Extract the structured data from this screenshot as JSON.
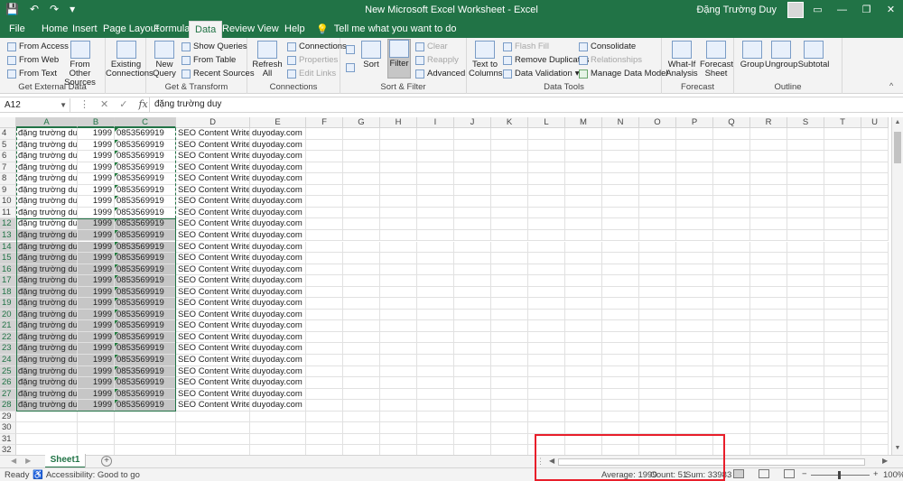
{
  "window": {
    "title": "New Microsoft Excel Worksheet  -  Excel",
    "user": "Đặng Trường Duy"
  },
  "tabs": [
    "File",
    "Home",
    "Insert",
    "Page Layout",
    "Formulas",
    "Data",
    "Review",
    "View",
    "Help"
  ],
  "active_tab": "Data",
  "tell_me": "Tell me what you want to do",
  "ribbon": {
    "get_external": {
      "label": "Get External Data",
      "from_access": "From Access",
      "from_web": "From Web",
      "from_text": "From Text",
      "from_other_1": "From Other",
      "from_other_2": "Sources",
      "existing_1": "Existing",
      "existing_2": "Connections"
    },
    "get_transform": {
      "label": "Get & Transform",
      "new_query_1": "New",
      "new_query_2": "Query",
      "show_queries": "Show Queries",
      "from_table": "From Table",
      "recent_sources": "Recent Sources"
    },
    "connections": {
      "label": "Connections",
      "refresh_1": "Refresh",
      "refresh_2": "All",
      "connections": "Connections",
      "properties": "Properties",
      "edit_links": "Edit Links"
    },
    "sort_filter": {
      "label": "Sort & Filter",
      "sort": "Sort",
      "filter": "Filter",
      "clear": "Clear",
      "reapply": "Reapply",
      "advanced": "Advanced"
    },
    "data_tools": {
      "label": "Data Tools",
      "text_to_columns_1": "Text to",
      "text_to_columns_2": "Columns",
      "flash_fill": "Flash Fill",
      "remove_duplicates": "Remove Duplicates",
      "data_validation": "Data Validation",
      "consolidate": "Consolidate",
      "relationships": "Relationships",
      "manage_data_model": "Manage Data Model"
    },
    "forecast": {
      "label": "Forecast",
      "whatif_1": "What-If",
      "whatif_2": "Analysis",
      "forecast_1": "Forecast",
      "forecast_2": "Sheet"
    },
    "outline": {
      "label": "Outline",
      "group": "Group",
      "ungroup": "Ungroup",
      "subtotal": "Subtotal"
    }
  },
  "formula_bar": {
    "name_box": "A12",
    "value": "đặng trường duy",
    "fx": "fx"
  },
  "columns": [
    "A",
    "B",
    "C",
    "D",
    "E",
    "F",
    "G",
    "H",
    "I",
    "J",
    "K",
    "L",
    "M",
    "N",
    "O",
    "P",
    "Q",
    "R",
    "S",
    "T",
    "U"
  ],
  "rows": [
    {
      "n": "4",
      "a": "đặng trường duy",
      "b": "1999",
      "c": "0853569919",
      "d": "SEO Content Writer",
      "e": "duyoday.com"
    },
    {
      "n": "5",
      "a": "đặng trường duy",
      "b": "1999",
      "c": "0853569919",
      "d": "SEO Content Writer",
      "e": "duyoday.com"
    },
    {
      "n": "6",
      "a": "đặng trường duy",
      "b": "1999",
      "c": "0853569919",
      "d": "SEO Content Writer",
      "e": "duyoday.com"
    },
    {
      "n": "7",
      "a": "đặng trường duy",
      "b": "1999",
      "c": "0853569919",
      "d": "SEO Content Writer",
      "e": "duyoday.com"
    },
    {
      "n": "8",
      "a": "đặng trường duy",
      "b": "1999",
      "c": "0853569919",
      "d": "SEO Content Writer",
      "e": "duyoday.com"
    },
    {
      "n": "9",
      "a": "đặng trường duy",
      "b": "1999",
      "c": "0853569919",
      "d": "SEO Content Writer",
      "e": "duyoday.com"
    },
    {
      "n": "10",
      "a": "đặng trường duy",
      "b": "1999",
      "c": "0853569919",
      "d": "SEO Content Writer",
      "e": "duyoday.com"
    },
    {
      "n": "11",
      "a": "đặng trường duy",
      "b": "1999",
      "c": "0853569919",
      "d": "SEO Content Writer",
      "e": "duyoday.com"
    },
    {
      "n": "12",
      "a": "đặng trường duy",
      "b": "1999",
      "c": "0853569919",
      "d": "SEO Content Writer",
      "e": "duyoday.com"
    },
    {
      "n": "13",
      "a": "đặng trường duy",
      "b": "1999",
      "c": "0853569919",
      "d": "SEO Content Writer",
      "e": "duyoday.com"
    },
    {
      "n": "14",
      "a": "đặng trường duy",
      "b": "1999",
      "c": "0853569919",
      "d": "SEO Content Writer",
      "e": "duyoday.com"
    },
    {
      "n": "15",
      "a": "đặng trường duy",
      "b": "1999",
      "c": "0853569919",
      "d": "SEO Content Writer",
      "e": "duyoday.com"
    },
    {
      "n": "16",
      "a": "đặng trường duy",
      "b": "1999",
      "c": "0853569919",
      "d": "SEO Content Writer",
      "e": "duyoday.com"
    },
    {
      "n": "17",
      "a": "đặng trường duy",
      "b": "1999",
      "c": "0853569919",
      "d": "SEO Content Writer",
      "e": "duyoday.com"
    },
    {
      "n": "18",
      "a": "đặng trường duy",
      "b": "1999",
      "c": "0853569919",
      "d": "SEO Content Writer",
      "e": "duyoday.com"
    },
    {
      "n": "19",
      "a": "đặng trường duy",
      "b": "1999",
      "c": "0853569919",
      "d": "SEO Content Writer",
      "e": "duyoday.com"
    },
    {
      "n": "20",
      "a": "đặng trường duy",
      "b": "1999",
      "c": "0853569919",
      "d": "SEO Content Writer",
      "e": "duyoday.com"
    },
    {
      "n": "21",
      "a": "đặng trường duy",
      "b": "1999",
      "c": "0853569919",
      "d": "SEO Content Writer",
      "e": "duyoday.com"
    },
    {
      "n": "22",
      "a": "đặng trường duy",
      "b": "1999",
      "c": "0853569919",
      "d": "SEO Content Writer",
      "e": "duyoday.com"
    },
    {
      "n": "23",
      "a": "đặng trường duy",
      "b": "1999",
      "c": "0853569919",
      "d": "SEO Content Writer",
      "e": "duyoday.com"
    },
    {
      "n": "24",
      "a": "đặng trường duy",
      "b": "1999",
      "c": "0853569919",
      "d": "SEO Content Writer",
      "e": "duyoday.com"
    },
    {
      "n": "25",
      "a": "đặng trường duy",
      "b": "1999",
      "c": "0853569919",
      "d": "SEO Content Writer",
      "e": "duyoday.com"
    },
    {
      "n": "26",
      "a": "đặng trường duy",
      "b": "1999",
      "c": "0853569919",
      "d": "SEO Content Writer",
      "e": "duyoday.com"
    },
    {
      "n": "27",
      "a": "đặng trường duy",
      "b": "1999",
      "c": "0853569919",
      "d": "SEO Content Writer",
      "e": "duyoday.com"
    },
    {
      "n": "28",
      "a": "đặng trường duy",
      "b": "1999",
      "c": "0853569919",
      "d": "SEO Content Writer",
      "e": "duyoday.com"
    },
    {
      "n": "29",
      "a": "",
      "b": "",
      "c": "",
      "d": "",
      "e": ""
    },
    {
      "n": "30",
      "a": "",
      "b": "",
      "c": "",
      "d": "",
      "e": ""
    },
    {
      "n": "31",
      "a": "",
      "b": "",
      "c": "",
      "d": "",
      "e": ""
    },
    {
      "n": "32",
      "a": "",
      "b": "",
      "c": "",
      "d": "",
      "e": ""
    }
  ],
  "sheets": [
    "Sheet1"
  ],
  "status": {
    "ready": "Ready",
    "accessibility": "Accessibility: Good to go",
    "average": "Average: 1999",
    "count": "Count: 51",
    "sum": "Sum: 33983",
    "zoom": "100%"
  },
  "colors": {
    "accent": "#217346",
    "highlight_box": "#e81e2a"
  }
}
